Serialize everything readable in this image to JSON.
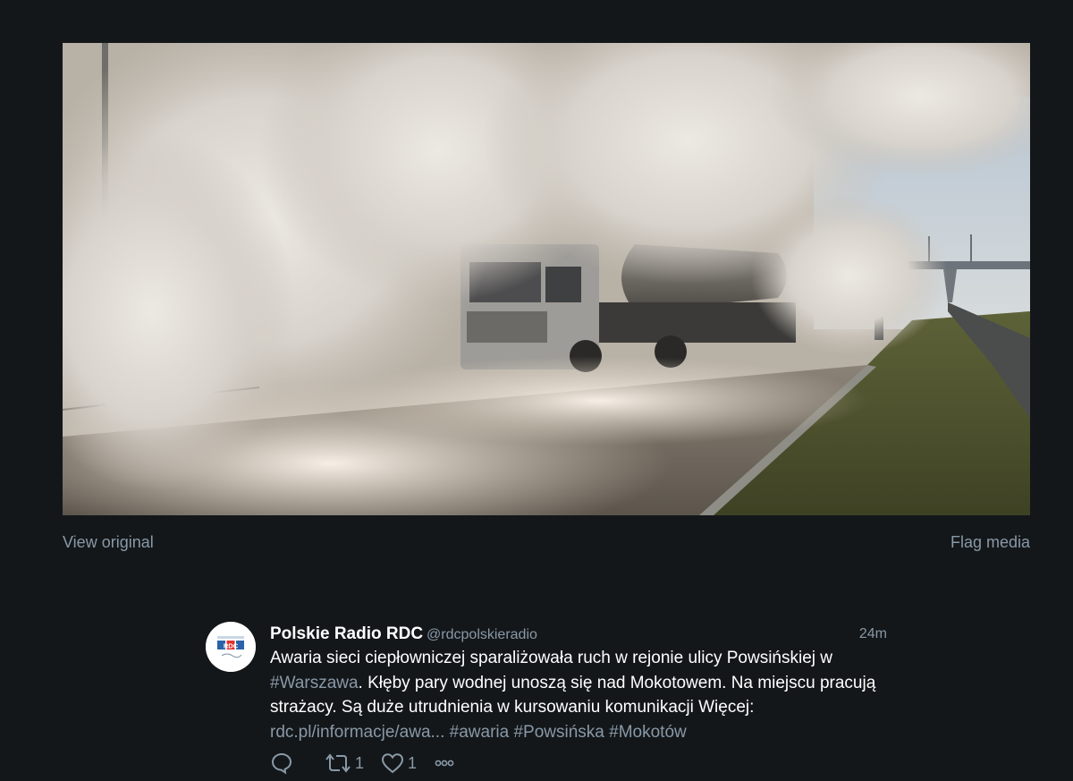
{
  "media": {
    "view_original_label": "View original",
    "flag_media_label": "Flag media"
  },
  "tweet": {
    "author_name": "Polskie Radio RDC",
    "author_handle": "@rdcpolskieradio",
    "timestamp": "24m",
    "avatar_logo_text": "RDC",
    "text_segments": [
      {
        "text": "Awaria sieci ciepłowniczej sparaliżowała ruch w rejonie ulicy Powsińskiej w ",
        "type": "text"
      },
      {
        "text": "#Warszawa",
        "type": "hashtag"
      },
      {
        "text": ". Kłęby pary wodnej unoszą się nad Mokotowem. Na miejscu pracują strażacy. Są duże utrudnienia w kursowaniu komunikacji Więcej: ",
        "type": "text"
      },
      {
        "text": "rdc.pl/informacje/awa...",
        "type": "link"
      },
      {
        "text": " ",
        "type": "text"
      },
      {
        "text": "#awaria",
        "type": "hashtag"
      },
      {
        "text": " ",
        "type": "text"
      },
      {
        "text": "#Powsińska",
        "type": "hashtag"
      },
      {
        "text": " ",
        "type": "text"
      },
      {
        "text": "#Mokotów",
        "type": "hashtag"
      }
    ],
    "actions": {
      "reply_icon": "reply-icon",
      "retweet_icon": "retweet-icon",
      "retweet_count": "1",
      "like_icon": "heart-icon",
      "like_count": "1",
      "more_icon": "more-icon"
    }
  },
  "colors": {
    "background": "#14171a",
    "secondary_text": "#8899a6",
    "primary_text": "#ffffff"
  }
}
